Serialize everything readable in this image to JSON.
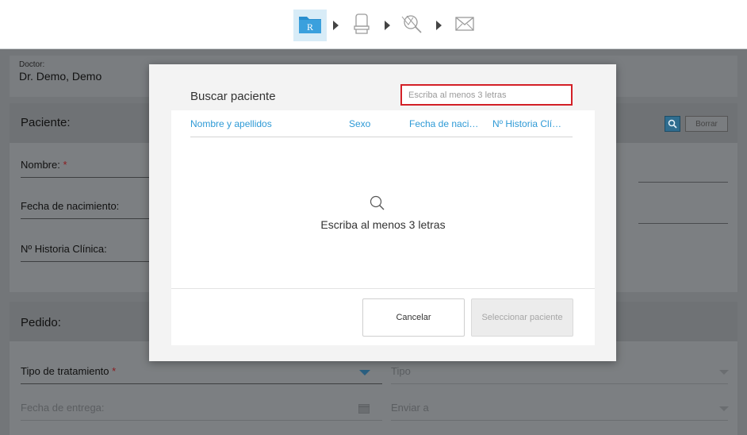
{
  "toolbar": {
    "steps": [
      {
        "name": "Rx",
        "label": "R",
        "active": true
      },
      {
        "name": "scan",
        "active": false
      },
      {
        "name": "view",
        "active": false
      },
      {
        "name": "send",
        "active": false
      }
    ]
  },
  "doctor": {
    "label": "Doctor:",
    "value": "Dr. Demo, Demo"
  },
  "patient": {
    "title": "Paciente:",
    "name_label": "Nombre:",
    "required_mark": "*",
    "birthdate_label": "Fecha de nacimiento:",
    "chart_label": "Nº Historia Clínica:",
    "clear_label": "Borrar"
  },
  "order": {
    "title": "Pedido:",
    "treatment_label": "Tipo de tratamiento",
    "required_mark": "*",
    "type_label": "Tipo",
    "delivery_label": "Fecha de entrega:",
    "send_to_label": "Enviar a"
  },
  "modal": {
    "title": "Buscar paciente",
    "search_placeholder": "Escriba al menos 3 letras",
    "columns": [
      "Nombre y apellidos",
      "Sexo",
      "Fecha de naci…",
      "Nº Historia Clí…"
    ],
    "empty_message": "Escriba al menos 3 letras",
    "cancel_label": "Cancelar",
    "select_label": "Seleccionar paciente"
  },
  "colors": {
    "accent": "#2e9ad6",
    "highlight": "#d32027",
    "required": "#d32027"
  }
}
